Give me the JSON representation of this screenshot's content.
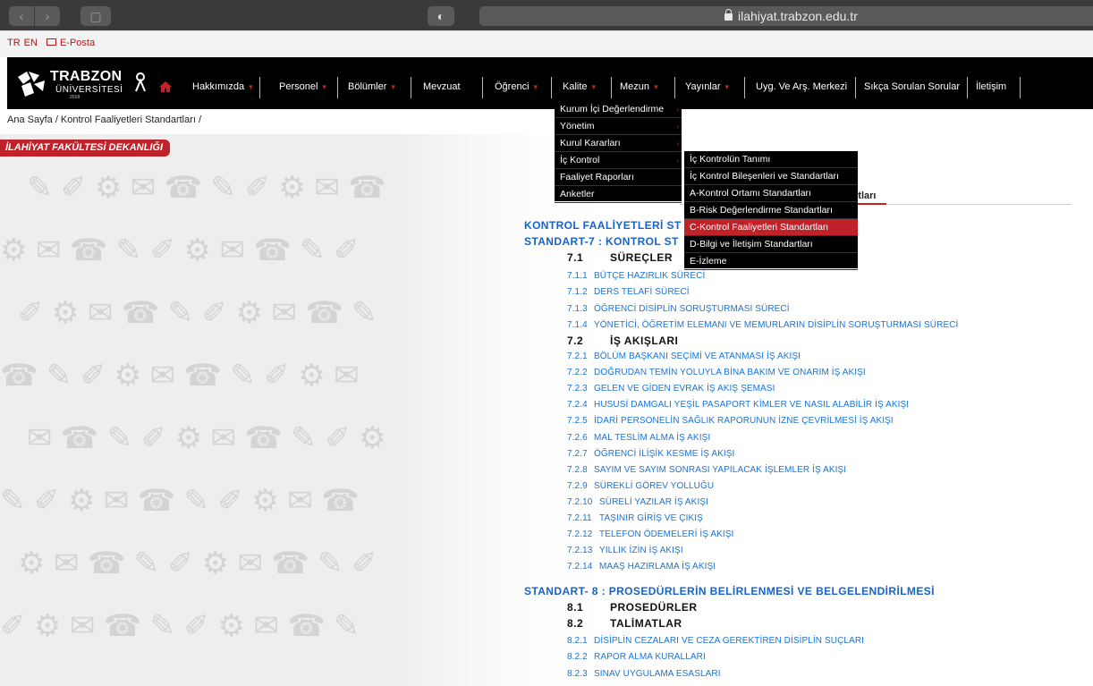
{
  "browser": {
    "url": "ilahiyat.trabzon.edu.tr"
  },
  "topbar": {
    "lang_tr": "TR",
    "lang_en": "EN",
    "email": "E-Posta"
  },
  "logo": {
    "line1": "TRABZON",
    "line2": "ÜNİVERSİTESİ",
    "line3": "2018"
  },
  "nav": {
    "items": [
      "Hakkımızda",
      "Personel",
      "Bölümler",
      "Mevzuat",
      "Öğrenci",
      "Kalite",
      "Mezun",
      "Yayınlar",
      "Uyg. Ve Arş. Merkezi",
      "Sıkça Sorulan Sorular",
      "İletişim"
    ]
  },
  "breadcrumb": "Ana Sayfa /  Kontrol Faaliyetleri Standartları /",
  "faculty_badge": "İLAHİYAT FAKÜLTESİ DEKANLIĞI",
  "tab_partial": "rtları",
  "kalite_menu": [
    "Kurum İçi Değerlendirme",
    "Yönetim",
    "Kurul Kararları",
    "İç Kontrol",
    "Faaliyet Raporları",
    "Anketler"
  ],
  "ic_kontrol_menu": [
    "İç Kontrolün Tanımı",
    "İç Kontrol Bileşenleri ve Standartları",
    "A-Kontrol Ortamı Standartları",
    "B-Risk Değerlendirme Standartları",
    "C-Kontrol Faaliyetleri Standartları",
    "D-Bilgi ve İletişim Standartları",
    "E-İzleme"
  ],
  "content": {
    "title1": "KONTROL FAALİYETLERİ ST",
    "title2": "STANDART-7 : KONTROL ST",
    "s71_num": "7.1",
    "s71_label": "SÜREÇLER",
    "s71_items": [
      {
        "num": "7.1.1",
        "label": "BÜTÇE HAZIRLIK SÜRECİ"
      },
      {
        "num": "7.1.2",
        "label": "DERS TELAFİ SÜRECİ"
      },
      {
        "num": "7.1.3",
        "label": "ÖĞRENCİ DİSİPLİN SORUŞTURMASI SÜRECİ"
      },
      {
        "num": "7.1.4",
        "label": "YÖNETİCİ, ÖĞRETİM ELEMANI VE MEMURLARIN DİSİPLİN SORUŞTURMASI SÜRECİ"
      }
    ],
    "s72_num": "7.2",
    "s72_label": "İŞ AKIŞLARI",
    "s72_items": [
      {
        "num": "7.2.1",
        "label": "BÖLÜM BAŞKANI SEÇİMİ VE ATANMASI İŞ AKIŞI"
      },
      {
        "num": "7.2.2",
        "label": "DOĞRUDAN TEMİN YOLUYLA BİNA BAKIM VE ONARIM İŞ AKIŞI"
      },
      {
        "num": "7.2.3",
        "label": "GELEN VE GİDEN EVRAK İŞ AKIŞ ŞEMASI"
      },
      {
        "num": "7.2.4",
        "label": "HUSUSİ DAMGALI YEŞİL PASAPORT KİMLER VE NASIL ALABİLİR İŞ AKIŞI"
      },
      {
        "num": "7.2.5",
        "label": "İDARİ PERSONELİN SAĞLIK RAPORUNUN İZNE ÇEVRİLMESİ İŞ AKIŞI"
      },
      {
        "num": "7.2.6",
        "label": "MAL TESLİM ALMA İŞ AKIŞI"
      },
      {
        "num": "7.2.7",
        "label": "ÖĞRENCİ İLİŞİK KESME İŞ AKIŞI"
      },
      {
        "num": "7.2.8",
        "label": "SAYIM VE SAYIM SONRASI YAPILACAK İŞLEMLER İŞ AKIŞI"
      },
      {
        "num": "7.2.9",
        "label": "SÜREKLİ GÖREV YOLLUĞU"
      },
      {
        "num": "7.2.10",
        "label": "SÜRELİ YAZILAR İŞ AKIŞI"
      },
      {
        "num": "7.2.11",
        "label": "TAŞINIR GİRİŞ VE ÇIKIŞ"
      },
      {
        "num": "7.2.12",
        "label": "TELEFON ÖDEMELERİ İŞ AKIŞI"
      },
      {
        "num": "7.2.13",
        "label": "YILLIK İZİN İŞ AKIŞI"
      },
      {
        "num": "7.2.14",
        "label": "MAAŞ HAZIRLAMA İŞ AKIŞI"
      }
    ],
    "title3": "STANDART- 8 : PROSEDÜRLERİN BELİRLENMESİ VE BELGELENDİRİLMESİ",
    "s81_num": "8.1",
    "s81_label": "PROSEDÜRLER",
    "s82_num": "8.2",
    "s82_label": "TALİMATLAR",
    "s82_items": [
      {
        "num": "8.2.1",
        "label": "DİSİPLİN CEZALARI VE CEZA GEREKTİREN DİSİPLİN SUÇLARI"
      },
      {
        "num": "8.2.2",
        "label": "RAPOR ALMA KURALLARI"
      },
      {
        "num": "8.2.3",
        "label": "SINAV UYGULAMA ESASLARI"
      }
    ]
  },
  "colors": {
    "brand_red": "#c0222a",
    "link_blue": "#1a73d6",
    "title_blue": "#1763c7"
  }
}
